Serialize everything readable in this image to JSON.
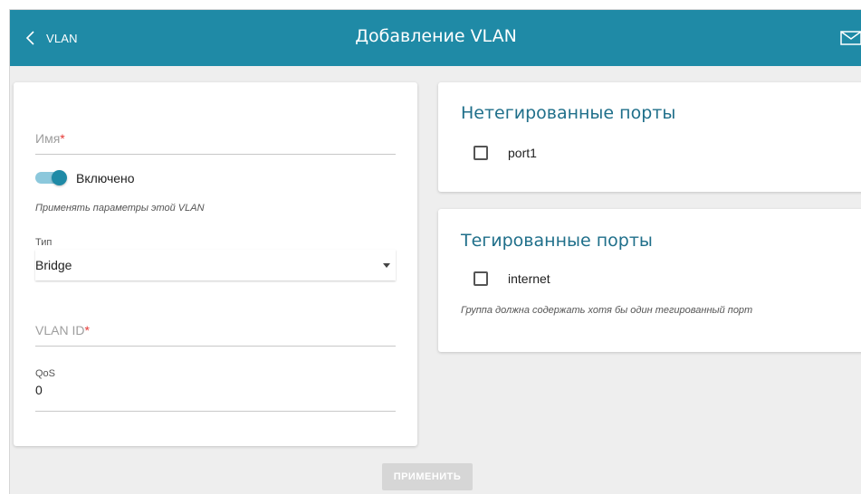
{
  "header": {
    "back_label": "VLAN",
    "title": "Добавление VLAN",
    "icons": {
      "back": "chevron-left-icon",
      "notifications": "mail-icon"
    }
  },
  "form": {
    "name": {
      "placeholder": "Имя",
      "required_mark": "*",
      "value": ""
    },
    "enabled": {
      "label": "Включено",
      "checked": true,
      "hint": "Применять параметры этой VLAN"
    },
    "type": {
      "label": "Тип",
      "value": "Bridge"
    },
    "vlan_id": {
      "placeholder": "VLAN ID",
      "required_mark": "*",
      "value": ""
    },
    "qos": {
      "label": "QoS",
      "value": "0"
    }
  },
  "untagged_ports": {
    "title": "Нетегированные порты",
    "ports": [
      {
        "label": "port1",
        "checked": false
      }
    ]
  },
  "tagged_ports": {
    "title": "Тегированные порты",
    "ports": [
      {
        "label": "internet",
        "checked": false
      }
    ],
    "hint": "Группа должна содержать хотя бы один тегированный порт"
  },
  "actions": {
    "apply_label": "ПРИМЕНИТЬ",
    "apply_enabled": false
  },
  "colors": {
    "header": "#1f8aa6",
    "accent": "#1f8aa6",
    "card_title": "#1f6f8a",
    "required": "#e53935",
    "background": "#eeeeee"
  }
}
